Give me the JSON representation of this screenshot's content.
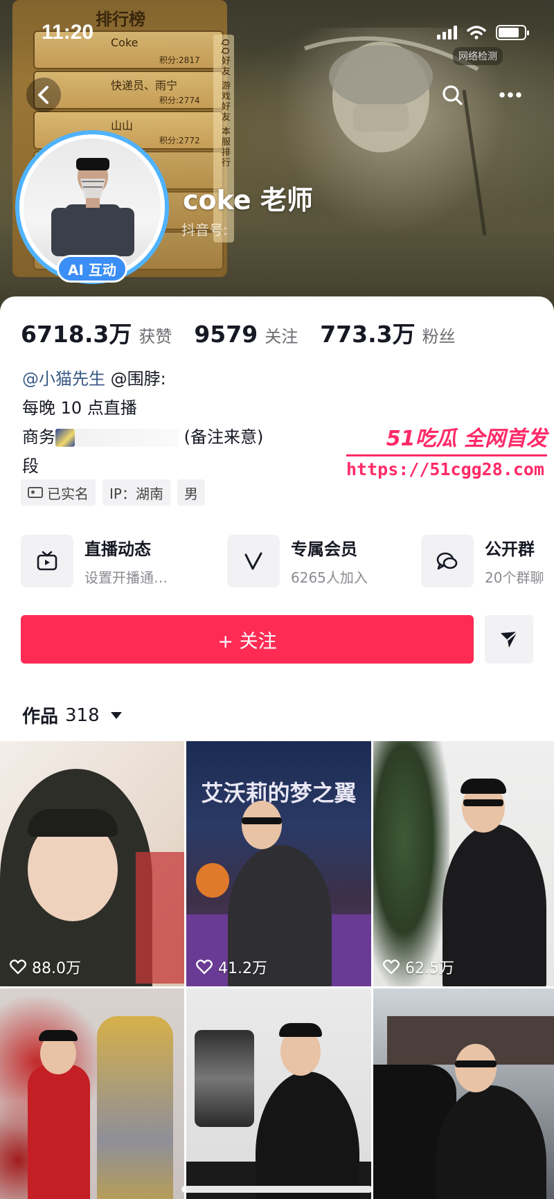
{
  "status_bar": {
    "time": "11:20"
  },
  "banner": {
    "rank_title": "排行榜",
    "rank_tabs": "QQ好友 游戏好友 本服排行",
    "rank_rows": [
      {
        "name": "Coke",
        "score": "积分:2817"
      },
      {
        "name": "快递员、雨宁",
        "score": "积分:2774"
      },
      {
        "name": "山山",
        "score": "积分:2772"
      }
    ],
    "net_check": "网络检测"
  },
  "profile": {
    "nickname": "coke 老师",
    "douyin_id": "抖音号:",
    "ai_badge": "AI 互动"
  },
  "stats": [
    {
      "num": "6718.3万",
      "label": "获赞"
    },
    {
      "num": "9579",
      "label": "关注"
    },
    {
      "num": "773.3万",
      "label": "粉丝"
    }
  ],
  "bio": {
    "mention_1": "@小猫先生",
    "mention_2": "@围脖:",
    "line_2": "每晚 10 点直播",
    "line_3_prefix": "商务",
    "line_3_note": "(备注来意)",
    "line_4": "段"
  },
  "tags": [
    "已实名",
    "IP：湖南",
    "男"
  ],
  "watermark": {
    "title": "51吃瓜 全网首发",
    "url": "https://51cgg28.com"
  },
  "features": [
    {
      "title": "直播动态",
      "sub": "设置开播通…",
      "icon": "tv-icon"
    },
    {
      "title": "专属会员",
      "sub": "6265人加入",
      "icon": "v-icon"
    },
    {
      "title": "公开群",
      "sub": "20个群聊",
      "icon": "chat-icon"
    }
  ],
  "follow_button": "+ 关注",
  "works": {
    "label": "作品",
    "count": "318"
  },
  "thumbnails": [
    {
      "likes": "88.0万"
    },
    {
      "likes": "41.2万",
      "caption": "艾沃莉的梦之翼"
    },
    {
      "likes": "62.5万"
    },
    {
      "likes": ""
    },
    {
      "likes": ""
    },
    {
      "likes": ""
    }
  ],
  "colors": {
    "accent": "#fe2c55",
    "badge": "#3a8ef6",
    "watermark": "#ff2a67"
  }
}
